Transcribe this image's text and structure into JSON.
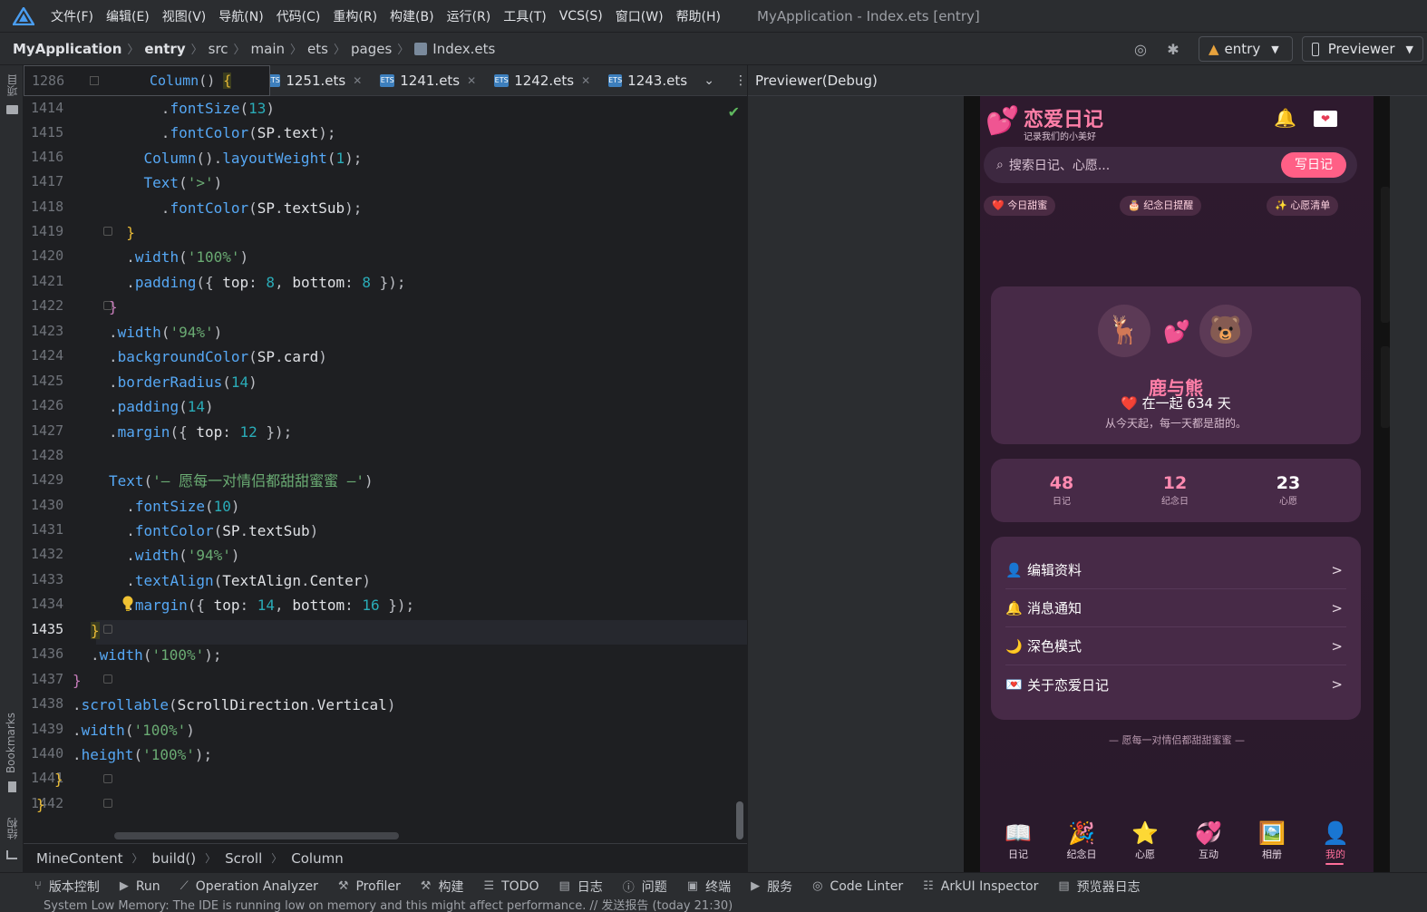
{
  "menubar": {
    "items": [
      "文件(F)",
      "编辑(E)",
      "视图(V)",
      "导航(N)",
      "代码(C)",
      "重构(R)",
      "构建(B)",
      "运行(R)",
      "工具(T)",
      "VCS(S)",
      "窗口(W)",
      "帮助(H)"
    ],
    "window_title": "MyApplication - Index.ets [entry]"
  },
  "navbar": {
    "crumbs": [
      "MyApplication",
      "entry",
      "src",
      "main",
      "ets",
      "pages",
      "Index.ets"
    ],
    "run_config": "entry",
    "previewer": "Previewer"
  },
  "leftstrip": {
    "project": "项目",
    "bookmarks": "Bookmarks",
    "structure": "结构"
  },
  "editor": {
    "sticky_line": "1286",
    "sticky_code": "Column() {",
    "tabs": [
      "1251.ets",
      "1241.ets",
      "1242.ets",
      "1243.ets"
    ],
    "line_numbers": [
      "1414",
      "1415",
      "1416",
      "1417",
      "1418",
      "1419",
      "1420",
      "1421",
      "1422",
      "1423",
      "1424",
      "1425",
      "1426",
      "1427",
      "1428",
      "1429",
      "1430",
      "1431",
      "1432",
      "1433",
      "1434",
      "1435",
      "1436",
      "1437",
      "1438",
      "1439",
      "1440",
      "1441",
      "1442"
    ],
    "current_line": "1435"
  },
  "breadcrumb": [
    "MineContent",
    "build()",
    "Scroll",
    "Column"
  ],
  "previewer": {
    "header": "Previewer(Debug)",
    "app": {
      "title": "恋爱日记",
      "subtitle": "记录我们的小美好",
      "search_placeholder": "搜索日记、心愿...",
      "write_button": "写日记",
      "chips": [
        "❤️ 今日甜蜜",
        "🎂 纪念日提醒",
        "✨ 心愿清单"
      ],
      "couple_name": "鹿与熊",
      "together_text": "❤️ 在一起 634 天",
      "quote": "从今天起，每一天都是甜的。",
      "stats": [
        {
          "value": "48",
          "label": "日记"
        },
        {
          "value": "12",
          "label": "纪念日"
        },
        {
          "value": "23",
          "label": "心愿"
        }
      ],
      "menu": [
        {
          "icon": "👤",
          "label": "编辑资料"
        },
        {
          "icon": "🔔",
          "label": "消息通知"
        },
        {
          "icon": "🌙",
          "label": "深色模式"
        },
        {
          "icon": "💌",
          "label": "关于恋爱日记"
        }
      ],
      "menu_arrow": ">",
      "footer": "— 愿每一对情侣都甜甜蜜蜜 —",
      "tabs": [
        {
          "icon": "📖",
          "label": "日记"
        },
        {
          "icon": "🎉",
          "label": "纪念日"
        },
        {
          "icon": "⭐",
          "label": "心愿"
        },
        {
          "icon": "💞",
          "label": "互动"
        },
        {
          "icon": "🖼️",
          "label": "相册"
        },
        {
          "icon": "👤",
          "label": "我的"
        }
      ]
    }
  },
  "statusbar": {
    "items": [
      {
        "icon": "⑂",
        "label": "版本控制"
      },
      {
        "icon": "▶",
        "label": "Run"
      },
      {
        "icon": "⟋",
        "label": "Operation Analyzer"
      },
      {
        "icon": "⚒",
        "label": "Profiler"
      },
      {
        "icon": "⚒",
        "label": "构建"
      },
      {
        "icon": "☰",
        "label": "TODO"
      },
      {
        "icon": "▤",
        "label": "日志"
      },
      {
        "icon": "ⓘ",
        "label": "问题"
      },
      {
        "icon": "▣",
        "label": "终端"
      },
      {
        "icon": "▶",
        "label": "服务"
      },
      {
        "icon": "◎",
        "label": "Code Linter"
      },
      {
        "icon": "☷",
        "label": "ArkUI Inspector"
      },
      {
        "icon": "▤",
        "label": "预览器日志"
      }
    ],
    "message": "System Low Memory: The IDE is running low on memory and this might affect performance. // 发送报告 (today 21:30)"
  },
  "colors": {
    "accent_pink": "#ff5f86",
    "app_bg": "#2e1a2e",
    "card": "#472a47",
    "ide_bg": "#1e1f22"
  }
}
